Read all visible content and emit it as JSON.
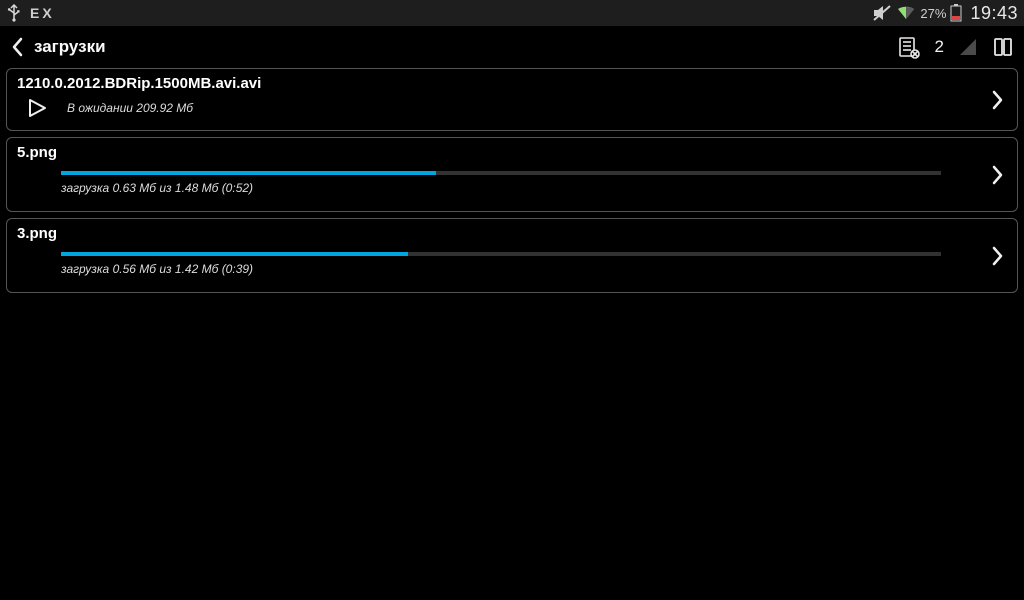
{
  "statusbar": {
    "left_label": "EX",
    "battery_text": "27%",
    "clock": "19:43"
  },
  "header": {
    "title": "загрузки",
    "queue_count": "2"
  },
  "downloads": [
    {
      "filename": "1210.0.2012.BDRip.1500MB.avi.avi",
      "status_text": "В ожидании 209.92 Мб",
      "kind": "pending"
    },
    {
      "filename": "5.png",
      "status_text": "загрузка 0.63 Мб из 1.48 Мб (0:52)",
      "progress_pct": 42.6,
      "kind": "active"
    },
    {
      "filename": "3.png",
      "status_text": "загрузка 0.56 Мб из 1.42 Мб (0:39)",
      "progress_pct": 39.4,
      "kind": "active"
    }
  ],
  "colors": {
    "accent": "#00a6e0",
    "border": "#555555",
    "text_dim": "#dcdcdc"
  }
}
